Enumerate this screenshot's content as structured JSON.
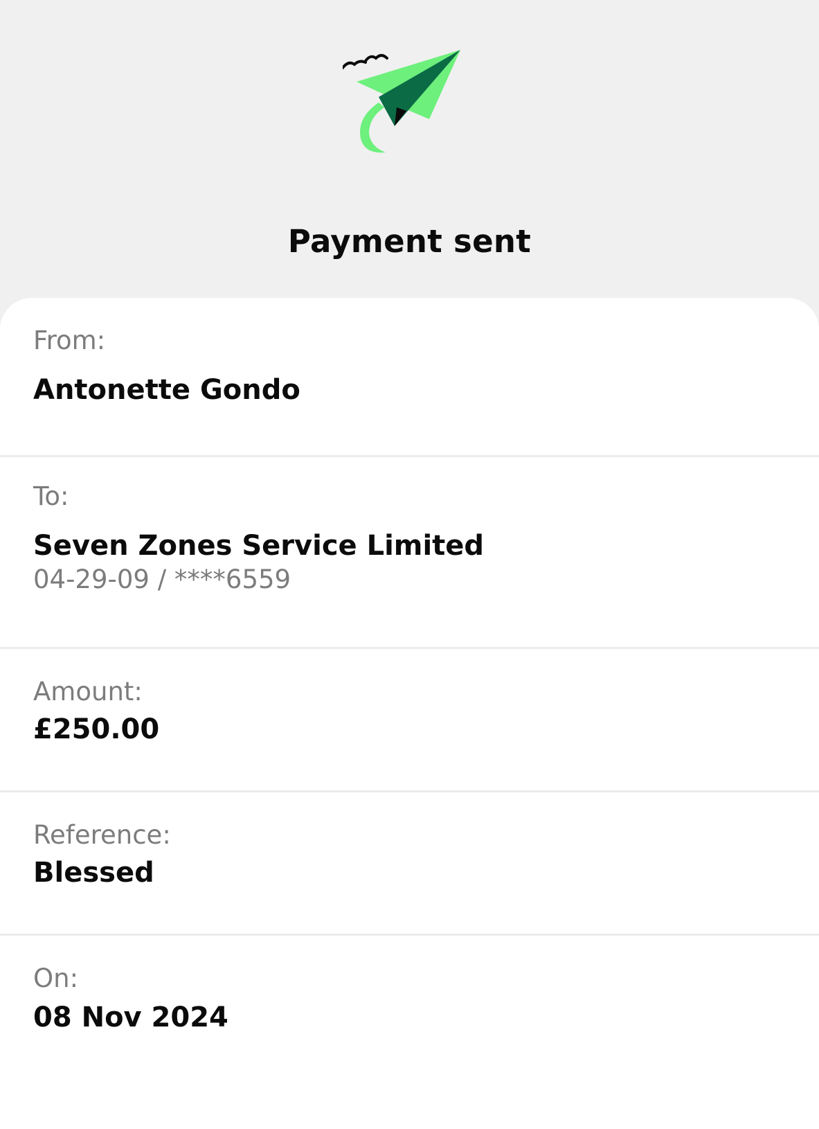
{
  "header": {
    "title": "Payment sent",
    "logo_icon": "paper-plane-icon"
  },
  "details": {
    "from": {
      "label": "From:",
      "value": "Antonette Gondo"
    },
    "to": {
      "label": "To:",
      "value": "Seven Zones Service Limited",
      "account": "04-29-09 / ****6559"
    },
    "amount": {
      "label": "Amount:",
      "value": "£250.00"
    },
    "reference": {
      "label": "Reference:",
      "value": "Blessed"
    },
    "on": {
      "label": "On:",
      "value": "08 Nov 2024"
    }
  },
  "colors": {
    "background": "#f0f0f0",
    "card": "#ffffff",
    "plane_light": "#6df07c",
    "plane_dark": "#0a6b45",
    "label": "#7c7c7c",
    "text": "#0b0b0b"
  }
}
